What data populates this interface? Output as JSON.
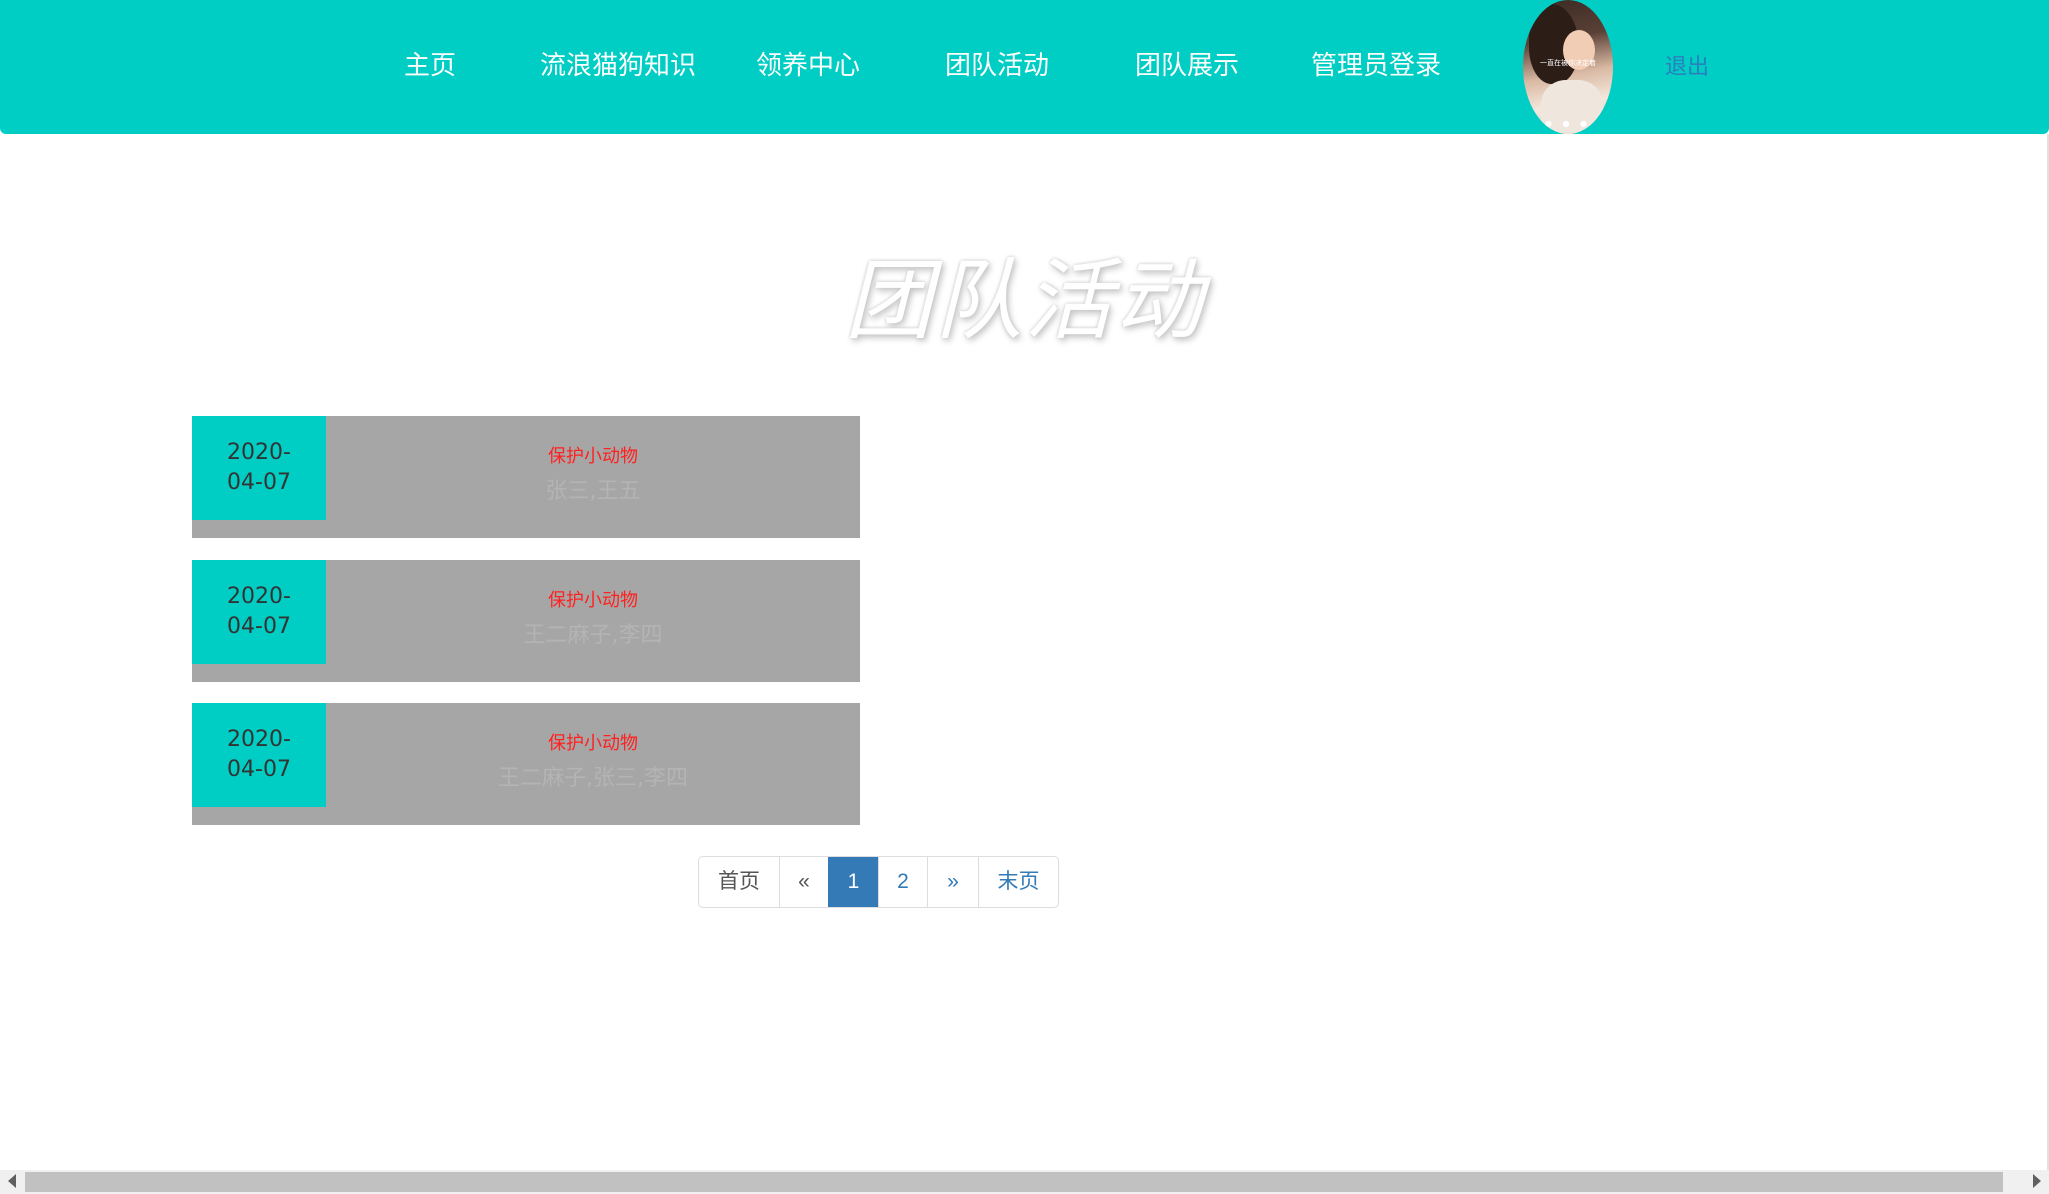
{
  "nav": {
    "items": [
      {
        "label": "主页"
      },
      {
        "label": "流浪猫狗知识"
      },
      {
        "label": "领养中心"
      },
      {
        "label": "团队活动"
      },
      {
        "label": "团队展示"
      },
      {
        "label": "管理员登录"
      }
    ],
    "avatar_caption": "一直在被你决定着",
    "logout": "退出"
  },
  "page_title": "团队活动",
  "activities": [
    {
      "date": "2020-04-07",
      "title": "保护小动物",
      "members": "张三,王五"
    },
    {
      "date": "2020-04-07",
      "title": "保护小动物",
      "members": "王二麻子,李四"
    },
    {
      "date": "2020-04-07",
      "title": "保护小动物",
      "members": "王二麻子,张三,李四"
    }
  ],
  "pagination": {
    "first": "首页",
    "prev": "«",
    "pages": [
      "1",
      "2"
    ],
    "current": "1",
    "next": "»",
    "last": "末页"
  },
  "colors": {
    "header": "#00cdc3",
    "date_block": "#00cdc3",
    "card": "#a6a6a6",
    "activity_title": "#ff2020",
    "pager_active": "#337ab7",
    "logout_link": "#2a7fbf"
  }
}
